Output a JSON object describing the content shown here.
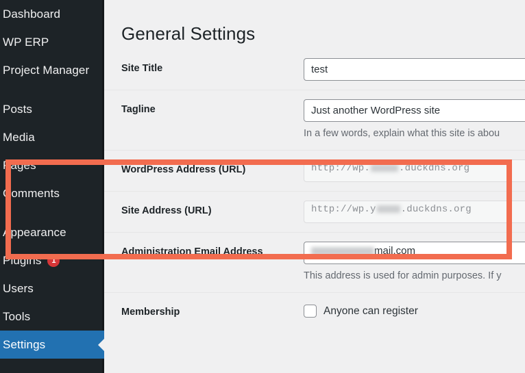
{
  "sidebar": {
    "items": [
      {
        "label": "Dashboard",
        "current": false,
        "badge": null,
        "gap_after": false
      },
      {
        "label": "WP ERP",
        "current": false,
        "badge": null,
        "gap_after": false
      },
      {
        "label": "Project Manager",
        "current": false,
        "badge": null,
        "gap_after": true
      },
      {
        "label": "Posts",
        "current": false,
        "badge": null,
        "gap_after": false
      },
      {
        "label": "Media",
        "current": false,
        "badge": null,
        "gap_after": false
      },
      {
        "label": "Pages",
        "current": false,
        "badge": null,
        "gap_after": false
      },
      {
        "label": "Comments",
        "current": false,
        "badge": null,
        "gap_after": true
      },
      {
        "label": "Appearance",
        "current": false,
        "badge": null,
        "gap_after": false
      },
      {
        "label": "Plugins",
        "current": false,
        "badge": "1",
        "gap_after": false
      },
      {
        "label": "Users",
        "current": false,
        "badge": null,
        "gap_after": false
      },
      {
        "label": "Tools",
        "current": false,
        "badge": null,
        "gap_after": false
      },
      {
        "label": "Settings",
        "current": true,
        "badge": null,
        "gap_after": false
      }
    ]
  },
  "page": {
    "title": "General Settings"
  },
  "fields": {
    "site_title": {
      "label": "Site Title",
      "value": "test"
    },
    "tagline": {
      "label": "Tagline",
      "value": "Just another WordPress site",
      "description": "In a few words, explain what this site is abou"
    },
    "wordpress_address": {
      "label": "WordPress Address (URL)",
      "value_prefix": "http://wp.",
      "value_suffix": ".duckdns.org",
      "redacted": true,
      "disabled": true
    },
    "site_address": {
      "label": "Site Address (URL)",
      "value_prefix": "http://wp.y",
      "value_suffix": ".duckdns.org",
      "redacted": true,
      "disabled": true
    },
    "admin_email": {
      "label": "Administration Email Address",
      "value_suffix": "mail.com",
      "redacted": true,
      "description": "This address is used for admin purposes. If y"
    },
    "membership": {
      "label": "Membership",
      "checkbox_label": "Anyone can register",
      "checked": false
    }
  },
  "annotation": {
    "highlight_color": "#f26c4f",
    "highlight_target": "url-fields"
  },
  "colors": {
    "sidebar_bg": "#1d2327",
    "sidebar_current": "#2271b1",
    "badge": "#d63638",
    "content_bg": "#f0f0f1",
    "text": "#1d2327",
    "muted_text": "#646970"
  }
}
